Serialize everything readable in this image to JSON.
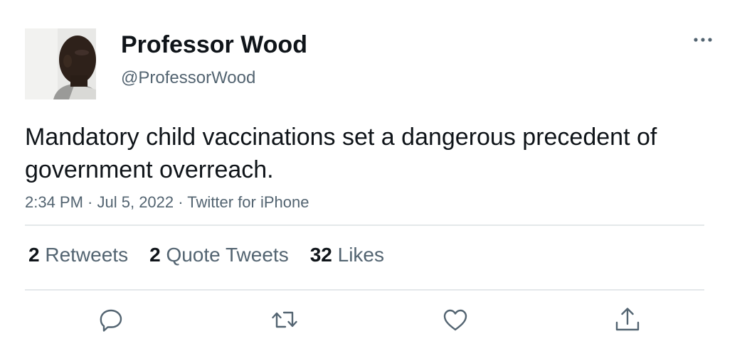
{
  "tweet": {
    "author": {
      "display_name": "Professor Wood",
      "handle": "@ProfessorWood"
    },
    "text": "Mandatory child vaccinations set a dangerous precedent of government overreach.",
    "meta": {
      "time": "2:34 PM",
      "date": "Jul 5, 2022",
      "source": "Twitter for iPhone",
      "separator": " · "
    },
    "stats": {
      "retweets": {
        "count": "2",
        "label": "Retweets"
      },
      "quote_tweets": {
        "count": "2",
        "label": "Quote Tweets"
      },
      "likes": {
        "count": "32",
        "label": "Likes"
      }
    },
    "icons": {
      "more": "more-horizontal-icon",
      "reply": "reply-icon",
      "retweet": "retweet-icon",
      "like": "heart-icon",
      "share": "share-icon"
    }
  },
  "colors": {
    "text_primary": "#0f1419",
    "text_secondary": "#536471",
    "divider": "#e4e8ea"
  }
}
